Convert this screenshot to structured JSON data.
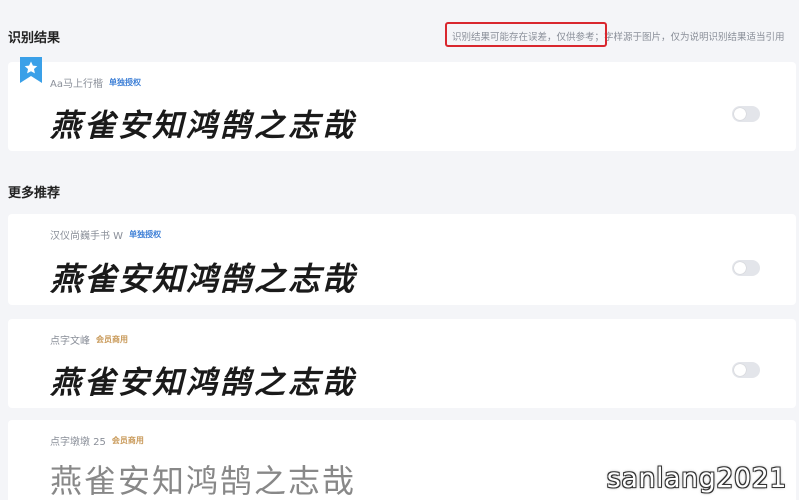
{
  "results_section": {
    "title": "识别结果",
    "disclaimer": "识别结果可能存在误差，仅供参考；字样源于图片，仅为说明识别结果适当引用"
  },
  "recommend_section": {
    "title": "更多推荐"
  },
  "cards": [
    {
      "font_name": "Aa马上行楷",
      "badge": "单独授权",
      "sample": "燕雀安知鸿鹄之志哉",
      "toggle_on": false
    },
    {
      "font_name": "汉仪尚巍手书 W",
      "badge": "单独授权",
      "sample": "燕雀安知鸿鹄之志哉",
      "toggle_on": false
    },
    {
      "font_name": "点字文峰",
      "badge": "会员商用",
      "sample": "燕雀安知鸿鹄之志哉",
      "toggle_on": false
    },
    {
      "font_name": "点字墩墩 25",
      "badge": "会员商用",
      "sample": "燕雀安知鸿鹄之志哉",
      "toggle_on": false
    }
  ],
  "icons": {
    "bookmark": "bookmark-star-icon"
  },
  "colors": {
    "bookmark": "#3aa0e8",
    "license_badge": "#3d7fd6",
    "member_badge": "#c99a5a",
    "highlight": "#d9272e"
  },
  "watermark": "sanlang2021"
}
